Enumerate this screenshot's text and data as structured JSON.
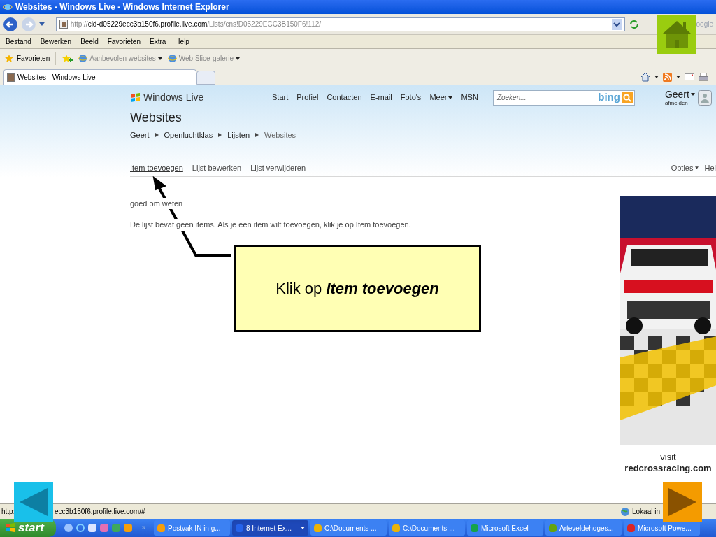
{
  "window": {
    "title": "Websites - Windows Live - Windows Internet Explorer"
  },
  "address_bar": {
    "scheme": "http://",
    "host": "cid-d05229ecc3b150f6.profile.live.com",
    "path": "/Lists/cns!D05229ECC3B150F6!112/"
  },
  "search_box": {
    "placeholder": "oogle"
  },
  "menu": [
    "Bestand",
    "Bewerken",
    "Beeld",
    "Favorieten",
    "Extra",
    "Help"
  ],
  "favorites_bar": {
    "label": "Favorieten",
    "links": [
      "Aanbevolen websites",
      "Web Slice-galerie"
    ]
  },
  "tabs": [
    {
      "label": "Websites - Windows Live",
      "selected": true
    }
  ],
  "page": {
    "brand": "Windows Live",
    "nav": [
      {
        "label": "Start",
        "menu": false
      },
      {
        "label": "Profiel",
        "menu": false
      },
      {
        "label": "Contacten",
        "menu": false
      },
      {
        "label": "E-mail",
        "menu": false
      },
      {
        "label": "Foto's",
        "menu": false
      },
      {
        "label": "Meer",
        "menu": true
      },
      {
        "label": "MSN",
        "menu": false
      }
    ],
    "search": {
      "placeholder": "Zoeken...",
      "engine": "bing"
    },
    "user": "Geert",
    "signout": "afmelden",
    "title": "Websites",
    "breadcrumb": [
      {
        "label": "Geert",
        "current": false
      },
      {
        "label": "Openluchtklas",
        "current": false
      },
      {
        "label": "Lijsten",
        "current": false
      },
      {
        "label": "Websites",
        "current": true
      }
    ],
    "actions": [
      {
        "label": "Item toevoegen",
        "selected": true
      },
      {
        "label": "Lijst bewerken",
        "selected": false
      },
      {
        "label": "Lijst verwijderen",
        "selected": false
      }
    ],
    "options": "Opties",
    "help": "Hel",
    "section_heading": "goed om weten",
    "message": "De lijst bevat geen items. Als je een item wilt toevoegen, klik je op Item toevoegen.",
    "ad": {
      "kind": "picture",
      "caption": [
        "visit",
        "redcrossracing.com"
      ]
    }
  },
  "callout": {
    "text": "Klik op **Item toevoegen**"
  },
  "status_bar": {
    "url_parts": [
      "http:",
      "ecc3b150f6.profile.live.com/#"
    ],
    "zone": "Lokaal in"
  },
  "taskbar": {
    "start": "start",
    "more": "»",
    "tasks": [
      {
        "label": "Postvak IN in g...",
        "selected": false,
        "color": "#f59e0b",
        "dropdown": false
      },
      {
        "label": "8 Internet Ex...",
        "selected": true,
        "color": "#2563eb",
        "dropdown": true
      },
      {
        "label": "C:\\Documents ...",
        "selected": false,
        "color": "#eab308",
        "dropdown": false
      },
      {
        "label": "C:\\Documents ...",
        "selected": false,
        "color": "#eab308",
        "dropdown": false
      },
      {
        "label": "Microsoft Excel",
        "selected": false,
        "color": "#16a34a",
        "dropdown": false
      },
      {
        "label": "Arteveldehoges...",
        "selected": false,
        "color": "#65a30d",
        "dropdown": false
      },
      {
        "label": "Microsoft Powe...",
        "selected": false,
        "color": "#dc2626",
        "dropdown": false
      }
    ]
  }
}
